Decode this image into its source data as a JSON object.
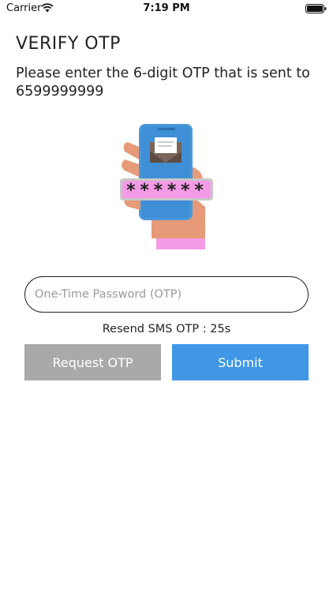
{
  "status_bar": {
    "carrier": "Carrier",
    "time": "7:19 PM"
  },
  "header": {
    "title": "VERIFY OTP",
    "subtitle": "Please enter the 6-digit OTP that is sent to 6599999999"
  },
  "illustration": {
    "masked_code": "******"
  },
  "otp_field": {
    "value": "",
    "placeholder": "One-Time Password (OTP)"
  },
  "resend": {
    "label": "Resend SMS OTP : 25s"
  },
  "buttons": {
    "request": "Request OTP",
    "submit": "Submit"
  },
  "colors": {
    "submit_bg": "#3f97e6",
    "request_bg": "#a9a9a9",
    "code_bar": "#f59ae6"
  }
}
